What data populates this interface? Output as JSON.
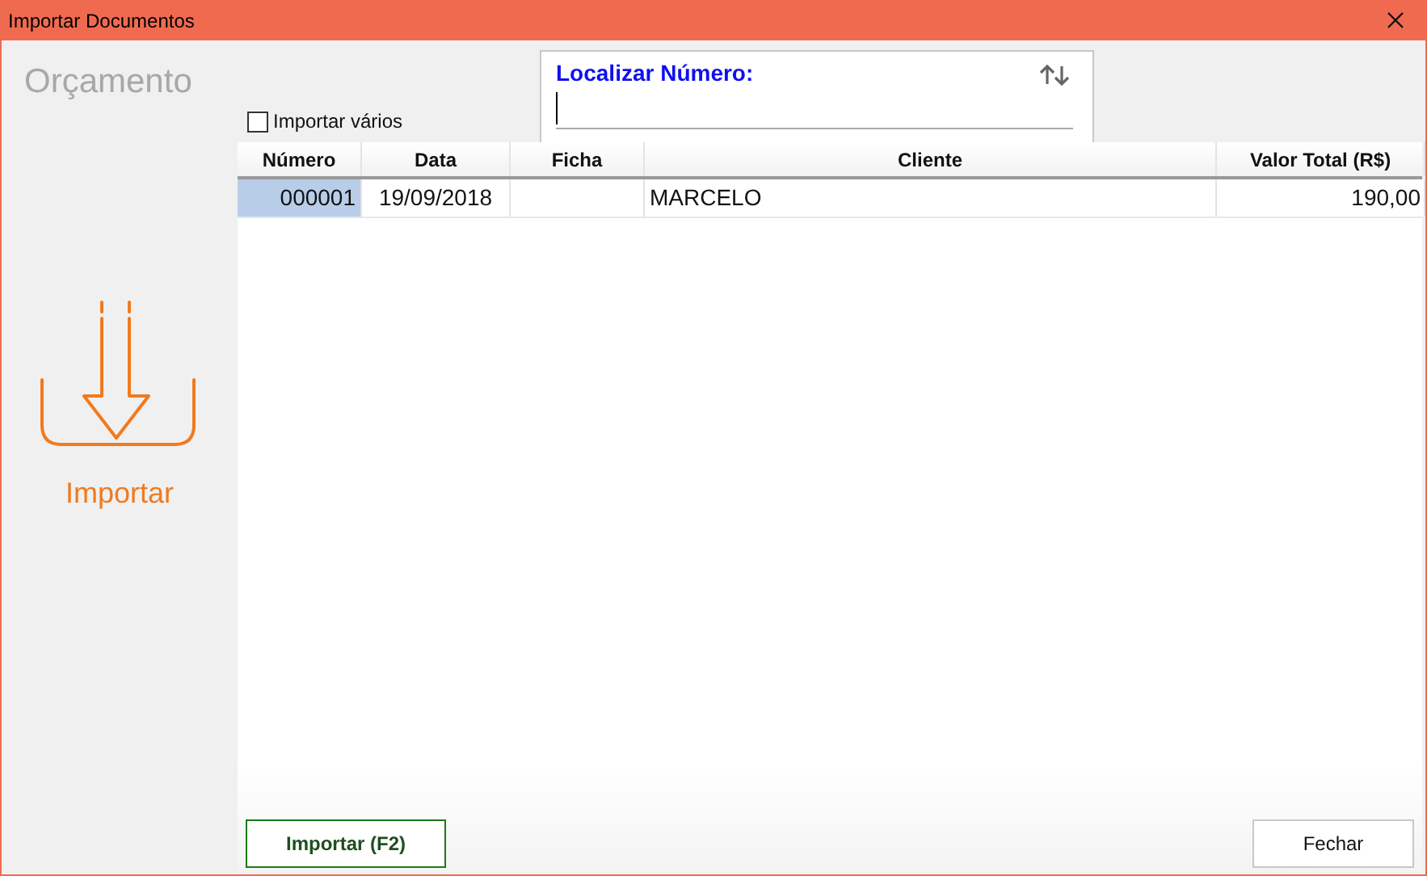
{
  "window": {
    "title": "Importar Documentos"
  },
  "sidebar": {
    "title": "Orçamento",
    "action_label": "Importar"
  },
  "import_multiple": {
    "label": "Importar vários",
    "checked": false
  },
  "search": {
    "label": "Localizar Número:"
  },
  "table": {
    "columns": [
      "Número",
      "Data",
      "Ficha",
      "Cliente",
      "Valor Total (R$)"
    ],
    "rows": [
      {
        "cells": [
          "000001",
          "19/09/2018",
          "",
          "MARCELO",
          "190,00"
        ],
        "selected": true
      }
    ]
  },
  "buttons": [
    {
      "label": "Importar (F2)",
      "kind": "primary"
    },
    {
      "label": "Fechar",
      "kind": "secondary"
    }
  ]
}
